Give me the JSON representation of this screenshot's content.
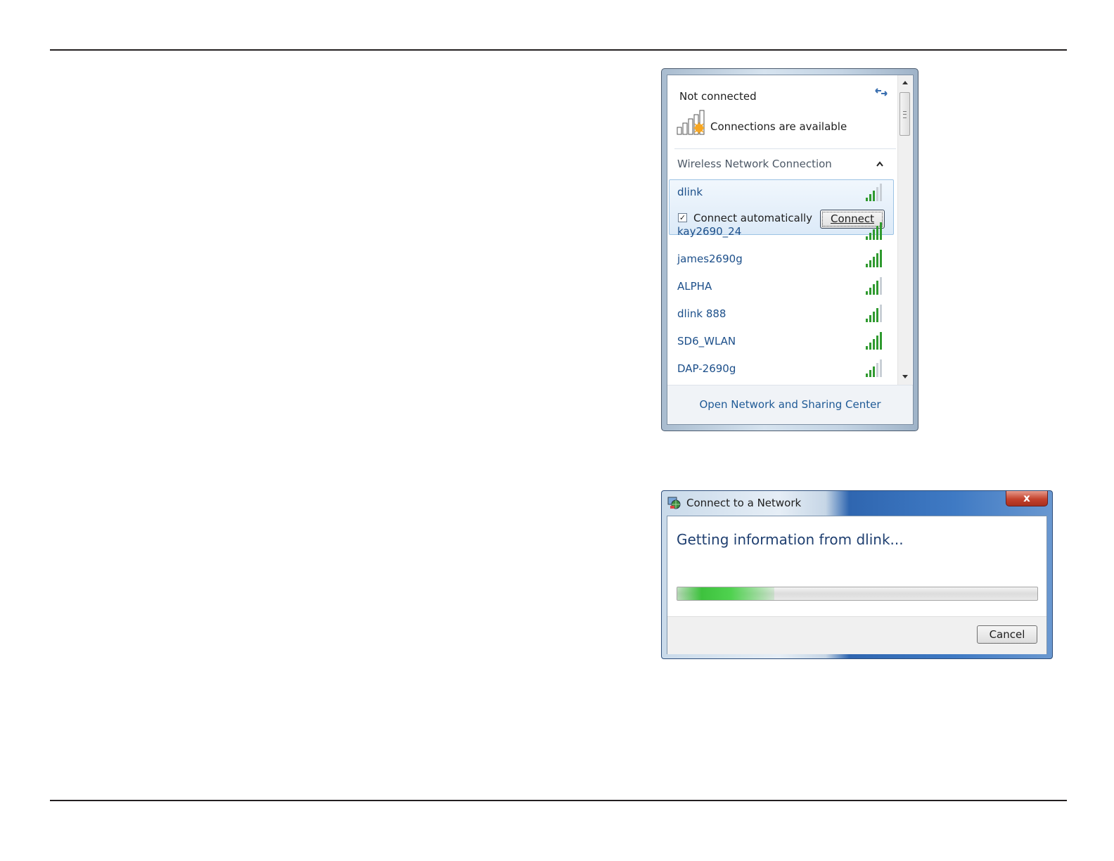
{
  "flyout": {
    "status": "Not connected",
    "availability": "Connections are available",
    "section_header": "Wireless Network Connection",
    "selected_network": {
      "name": "dlink",
      "signal_bars": 3,
      "connect_automatically_label": "Connect automatically",
      "connect_automatically_checked": true,
      "checkbox_glyph": "✓",
      "connect_button_label": "Connect"
    },
    "networks": [
      {
        "name": "kay2690_24",
        "signal_bars": 5
      },
      {
        "name": "james2690g",
        "signal_bars": 5
      },
      {
        "name": "ALPHA",
        "signal_bars": 4
      },
      {
        "name": "dlink 888",
        "signal_bars": 4
      },
      {
        "name": "SD6_WLAN",
        "signal_bars": 5
      },
      {
        "name": "DAP-2690g",
        "signal_bars": 3
      }
    ],
    "footer_link": "Open Network and Sharing Center"
  },
  "dialog": {
    "title": "Connect to a Network",
    "close_glyph": "x",
    "message": "Getting information from dlink...",
    "progress_fraction": 0.27,
    "cancel_label": "Cancel"
  },
  "colors": {
    "signal_active": "#2f9a2f",
    "signal_inactive": "#c9cfd6",
    "link": "#1f5a96"
  }
}
